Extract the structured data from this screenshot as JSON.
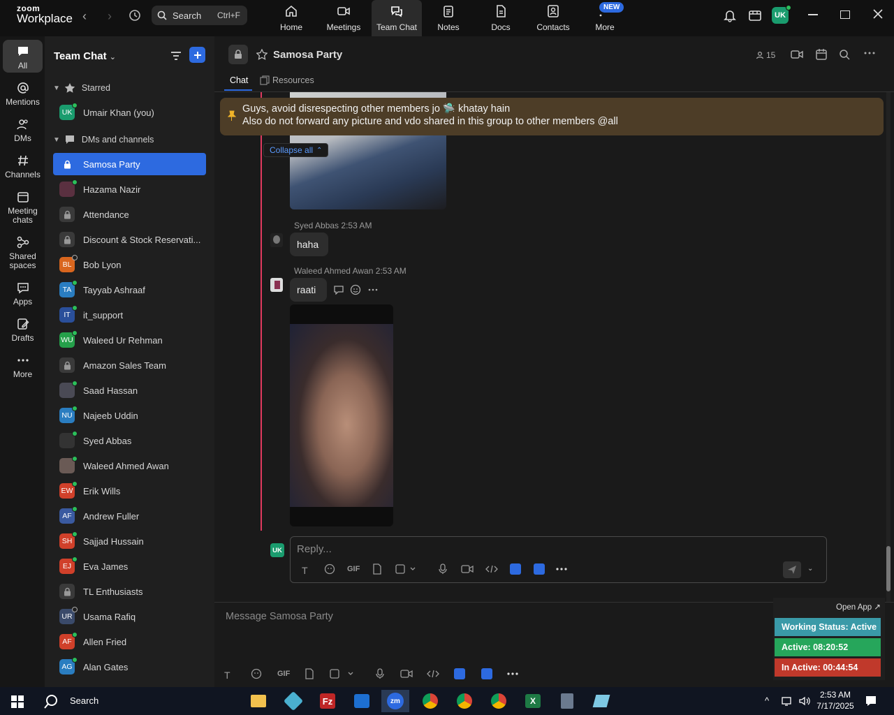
{
  "app": {
    "brand_top": "zoom",
    "brand_bottom": "Workplace"
  },
  "search": {
    "label": "Search",
    "shortcut": "Ctrl+F"
  },
  "tabs": [
    {
      "label": "Home",
      "icon": "home-icon"
    },
    {
      "label": "Meetings",
      "icon": "video-icon"
    },
    {
      "label": "Team Chat",
      "icon": "chat-icon"
    },
    {
      "label": "Notes",
      "icon": "notes-icon"
    },
    {
      "label": "Docs",
      "icon": "docs-icon"
    },
    {
      "label": "Contacts",
      "icon": "contacts-icon"
    },
    {
      "label": "More",
      "icon": "more-icon"
    }
  ],
  "new_badge": "NEW",
  "user_avatar": "UK",
  "rail": [
    {
      "label": "All"
    },
    {
      "label": "Mentions"
    },
    {
      "label": "DMs"
    },
    {
      "label": "Channels"
    },
    {
      "label": "Meeting chats"
    },
    {
      "label": "Shared spaces"
    },
    {
      "label": "Apps"
    },
    {
      "label": "Drafts"
    },
    {
      "label": "More"
    }
  ],
  "sidebar": {
    "title": "Team Chat",
    "starred_label": "Starred",
    "starred": [
      {
        "initials": "UK",
        "name": "Umair Khan (you)",
        "color": "#1a9c6e"
      }
    ],
    "dms_label": "DMs and channels",
    "items": [
      {
        "initials": "",
        "name": "Samosa Party",
        "type": "lock"
      },
      {
        "initials": "",
        "name": "Hazama Nazir",
        "type": "photo",
        "color": "#5a3040",
        "status": "on"
      },
      {
        "initials": "",
        "name": "Attendance",
        "type": "lock"
      },
      {
        "initials": "",
        "name": "Discount & Stock Reservati...",
        "type": "lock"
      },
      {
        "initials": "BL",
        "name": "Bob Lyon",
        "color": "#d9661e",
        "status": "off"
      },
      {
        "initials": "TA",
        "name": "Tayyab Ashraaf",
        "color": "#2a7dc0",
        "status": "on"
      },
      {
        "initials": "IT",
        "name": "it_support",
        "type": "photo",
        "color": "#2a4f9a",
        "status": "on"
      },
      {
        "initials": "WU",
        "name": "Waleed Ur Rehman",
        "color": "#25a04a",
        "status": "on"
      },
      {
        "initials": "",
        "name": "Amazon Sales Team",
        "type": "lock"
      },
      {
        "initials": "",
        "name": "Saad Hassan",
        "type": "photo",
        "color": "#4a4a55",
        "status": "on"
      },
      {
        "initials": "NU",
        "name": "Najeeb Uddin",
        "color": "#2a7dc0",
        "status": "on"
      },
      {
        "initials": "",
        "name": "Syed Abbas",
        "type": "photo",
        "color": "#333",
        "status": "on"
      },
      {
        "initials": "",
        "name": "Waleed Ahmed Awan",
        "type": "photo",
        "color": "#6a5a55",
        "status": "on"
      },
      {
        "initials": "EW",
        "name": "Erik Wills",
        "color": "#d0402a",
        "status": "on"
      },
      {
        "initials": "AF",
        "name": "Andrew Fuller",
        "color": "#3a5aa0",
        "status": "on"
      },
      {
        "initials": "SH",
        "name": "Sajjad Hussain",
        "color": "#d0402a",
        "status": "on"
      },
      {
        "initials": "EJ",
        "name": "Eva James",
        "color": "#d0402a",
        "status": "on"
      },
      {
        "initials": "",
        "name": "TL Enthusiasts",
        "type": "lock"
      },
      {
        "initials": "UR",
        "name": "Usama Rafiq",
        "color": "#3a4a6a",
        "status": "off"
      },
      {
        "initials": "AF",
        "name": "Allen Fried",
        "color": "#d0402a",
        "status": "on"
      },
      {
        "initials": "AG",
        "name": "Alan Gates",
        "color": "#2a7dc0",
        "status": "on"
      }
    ]
  },
  "chat": {
    "title": "Samosa Party",
    "member_count": "15",
    "tabs": [
      "Chat",
      "Resources"
    ],
    "pinned_line1": "Guys, avoid disrespecting other members jo 🛸 khatay hain",
    "pinned_line2": "Also do not forward any picture and vdo shared in this group to other members @all",
    "collapse_label": "Collapse all",
    "messages": [
      {
        "name": "Syed Abbas",
        "time": "2:53 AM",
        "text": "haha"
      },
      {
        "name": "Waleed Ahmed Awan",
        "time": "2:53 AM",
        "text": "raati"
      }
    ],
    "reply_placeholder": "Reply...",
    "reply_avatar": "UK",
    "composer_placeholder": "Message Samosa Party",
    "gif_label": "GIF"
  },
  "widget": {
    "open_app": "Open App ↗",
    "working": "Working Status: Active",
    "active": "Active: 08:20:52",
    "inactive": "In Active: 00:44:54",
    "colors": {
      "working": "#3a9aa8",
      "active": "#26a65b",
      "inactive": "#c0392b"
    }
  },
  "taskbar": {
    "search": "Search",
    "time": "2:53 AM",
    "date": "7/17/2025"
  }
}
